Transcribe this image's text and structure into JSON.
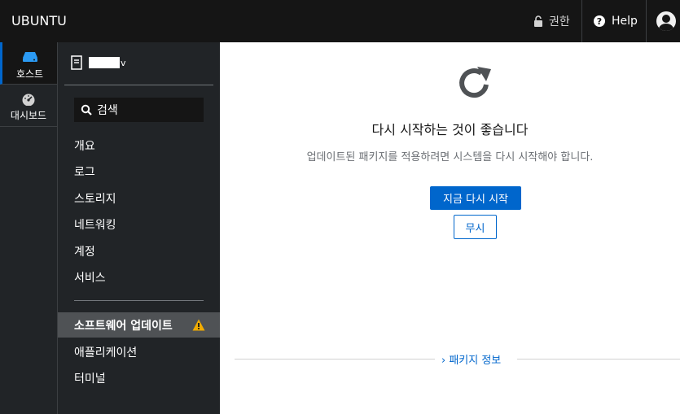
{
  "topbar": {
    "brand": "UBUNTU",
    "privileges_label": "권한",
    "help_label": "Help",
    "lock_icon": "lock-open-icon",
    "help_icon": "question-circle-icon",
    "user_icon": "user-avatar-icon"
  },
  "rail": {
    "items": [
      {
        "label": "호스트",
        "icon": "server-icon",
        "active": true
      },
      {
        "label": "대시보드",
        "icon": "dashboard-gauge-icon",
        "active": false
      }
    ]
  },
  "sidebar": {
    "host_caret": "v",
    "search_label": "검색",
    "items": [
      {
        "label": "개요"
      },
      {
        "label": "로그"
      },
      {
        "label": "스토리지"
      },
      {
        "label": "네트워킹"
      },
      {
        "label": "계정"
      },
      {
        "label": "서비스"
      }
    ],
    "items2": [
      {
        "label": "소프트웨어 업데이트",
        "active": true,
        "badge": "warning-icon"
      },
      {
        "label": "애플리케이션"
      },
      {
        "label": "터미널"
      }
    ]
  },
  "main": {
    "icon": "restart-icon",
    "headline": "다시 시작하는 것이 좋습니다",
    "description": "업데이트된 패키지를 적용하려면 시스템을 다시 시작해야 합니다.",
    "primary_button": "지금 다시 시작",
    "secondary_button": "무시",
    "expander": "› 패키지 정보"
  },
  "colors": {
    "accent": "#0066cc",
    "warning": "#f0ab00",
    "topbar": "#151515",
    "sidebar": "#212427"
  }
}
